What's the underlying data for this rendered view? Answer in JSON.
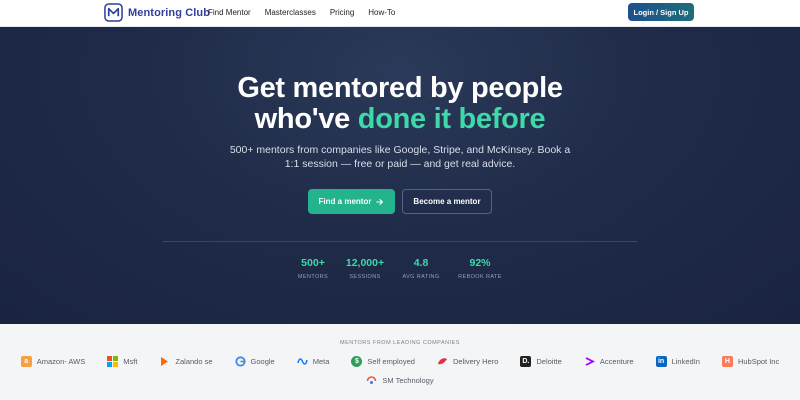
{
  "header": {
    "brand": "Mentoring Club",
    "nav": [
      "Find Mentor",
      "Masterclasses",
      "Pricing",
      "How-To"
    ],
    "login_label": "Login / Sign Up"
  },
  "hero": {
    "title_line1": "Get mentored by people",
    "title_line2_prefix": "who've ",
    "title_line2_accent": "done it before",
    "subtitle_line1": "500+ mentors from companies like Google, Stripe, and McKinsey. Book a",
    "subtitle_line2": "1:1 session — free or paid — and get real advice.",
    "primary_label": "Find a mentor",
    "secondary_label": "Become a mentor"
  },
  "stats": [
    {
      "value": "500+",
      "label": "MENTORS"
    },
    {
      "value": "12,000+",
      "label": "SESSIONS"
    },
    {
      "value": "4.8",
      "label": "AVG RATING"
    },
    {
      "value": "92%",
      "label": "REBOOK RATE"
    }
  ],
  "companies": {
    "title": "MENTORS FROM LEADING COMPANIES",
    "items": [
      {
        "name": "Amazon- AWS",
        "icon": "amazon-icon",
        "color": "#f6a043"
      },
      {
        "name": "Msft",
        "icon": "microsoft-icon",
        "color": "#f25022"
      },
      {
        "name": "Zalando se",
        "icon": "zalando-icon",
        "color": "#ff6900"
      },
      {
        "name": "Google",
        "icon": "google-icon",
        "color": "#4285f4"
      },
      {
        "name": "Meta",
        "icon": "meta-icon",
        "color": "#1877f2"
      },
      {
        "name": "Self employed",
        "icon": "dollar-icon",
        "color": "#2e9e5a"
      },
      {
        "name": "Delivery Hero",
        "icon": "delivery-hero-icon",
        "color": "#e5303b"
      },
      {
        "name": "Deloitte",
        "icon": "deloitte-icon",
        "color": "#222222"
      },
      {
        "name": "Accenture",
        "icon": "accenture-icon",
        "color": "#a100ff"
      },
      {
        "name": "LinkedIn",
        "icon": "linkedin-icon",
        "color": "#0a66c2"
      },
      {
        "name": "HubSpot Inc",
        "icon": "hubspot-icon",
        "color": "#ff7a59"
      },
      {
        "name": "SM Technology",
        "icon": "sm-technology-icon",
        "color": "#e9553c"
      }
    ]
  },
  "colors": {
    "accent": "#3fd9a9",
    "primary_button": "#23b38d",
    "hero_bg": "#1f2b48",
    "brand": "#2f3f9b"
  }
}
